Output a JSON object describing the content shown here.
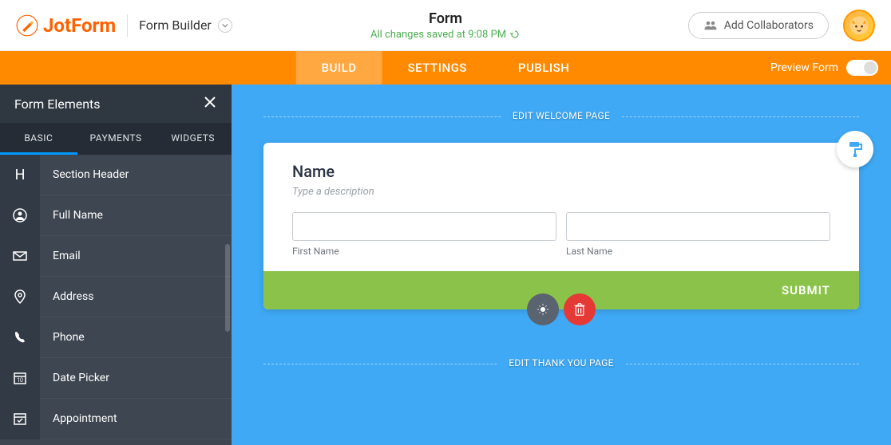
{
  "brand": {
    "name": "JotForm"
  },
  "header": {
    "builder_label": "Form Builder",
    "title": "Form",
    "save_status": "All changes saved at 9:08 PM",
    "collab_label": "Add Collaborators"
  },
  "nav": {
    "tabs": [
      {
        "label": "BUILD",
        "active": true
      },
      {
        "label": "SETTINGS",
        "active": false
      },
      {
        "label": "PUBLISH",
        "active": false
      }
    ],
    "preview_label": "Preview Form"
  },
  "sidebar": {
    "title": "Form Elements",
    "tabs": [
      {
        "label": "BASIC",
        "active": true
      },
      {
        "label": "PAYMENTS",
        "active": false
      },
      {
        "label": "WIDGETS",
        "active": false
      }
    ],
    "elements": [
      {
        "label": "Section Header",
        "icon": "heading-icon"
      },
      {
        "label": "Full Name",
        "icon": "user-icon"
      },
      {
        "label": "Email",
        "icon": "envelope-icon"
      },
      {
        "label": "Address",
        "icon": "location-icon"
      },
      {
        "label": "Phone",
        "icon": "phone-icon"
      },
      {
        "label": "Date Picker",
        "icon": "calendar-icon"
      },
      {
        "label": "Appointment",
        "icon": "calendar-check-icon"
      }
    ]
  },
  "canvas": {
    "welcome_label": "EDIT WELCOME PAGE",
    "thankyou_label": "EDIT THANK YOU PAGE",
    "field": {
      "title": "Name",
      "description_placeholder": "Type a description",
      "first_label": "First Name",
      "last_label": "Last Name"
    },
    "submit_label": "SUBMIT"
  }
}
